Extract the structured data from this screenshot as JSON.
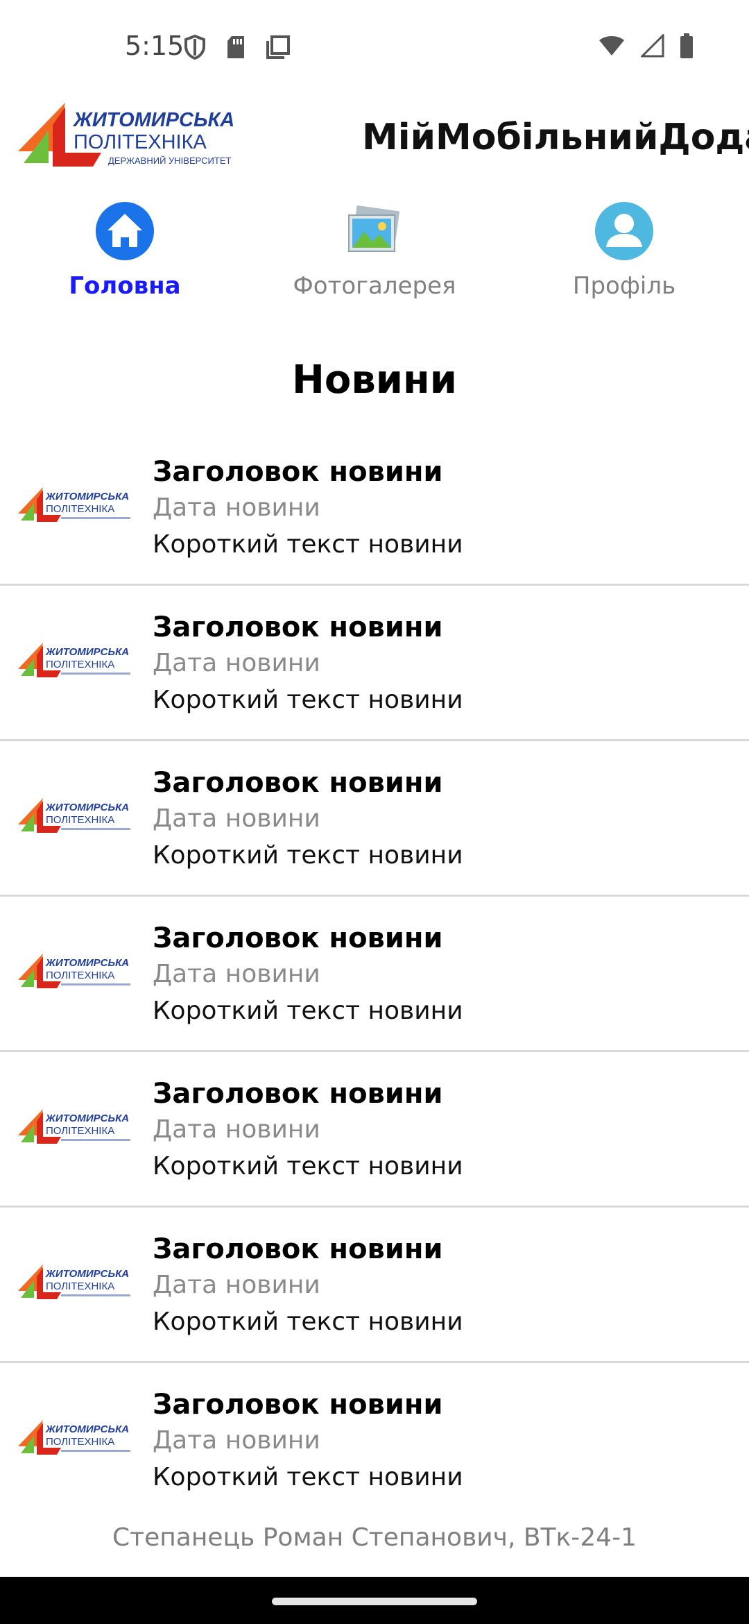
{
  "status_bar": {
    "time": "5:15",
    "icons_left": [
      "shield-icon",
      "sd-card-icon",
      "screenshot-icon"
    ],
    "icons_right": [
      "wifi-icon",
      "cell-signal-icon",
      "battery-icon"
    ]
  },
  "header": {
    "logo_line1": "ЖИТОМИРСЬКА",
    "logo_line2": "ПОЛІТЕХНІКА",
    "logo_line3": "ДЕРЖАВНИЙ УНІВЕРСИТЕТ",
    "app_title": "МійМобільнийДодаток"
  },
  "tabs": [
    {
      "label": "Головна",
      "icon": "home-icon",
      "active": true
    },
    {
      "label": "Фотогалерея",
      "icon": "gallery-icon",
      "active": false
    },
    {
      "label": "Профіль",
      "icon": "profile-icon",
      "active": false
    }
  ],
  "section_title": "Новини",
  "news": [
    {
      "title": "Заголовок новини",
      "date": "Дата новини",
      "text": "Короткий текст новини"
    },
    {
      "title": "Заголовок новини",
      "date": "Дата новини",
      "text": "Короткий текст новини"
    },
    {
      "title": "Заголовок новини",
      "date": "Дата новини",
      "text": "Короткий текст новини"
    },
    {
      "title": "Заголовок новини",
      "date": "Дата новини",
      "text": "Короткий текст новини"
    },
    {
      "title": "Заголовок новини",
      "date": "Дата новини",
      "text": "Короткий текст новини"
    },
    {
      "title": "Заголовок новини",
      "date": "Дата новини",
      "text": "Короткий текст новини"
    },
    {
      "title": "Заголовок новини",
      "date": "Дата новини",
      "text": "Короткий текст новини"
    }
  ],
  "footer": "Степанець Роман Степанович, ВТк-24-1",
  "colors": {
    "active_tab": "#1a1aff",
    "inactive_tab": "#808080",
    "logo_blue": "#1f3f9a",
    "logo_orange": "#f26a21",
    "logo_red": "#d9261c",
    "logo_green": "#6bbf3a"
  }
}
